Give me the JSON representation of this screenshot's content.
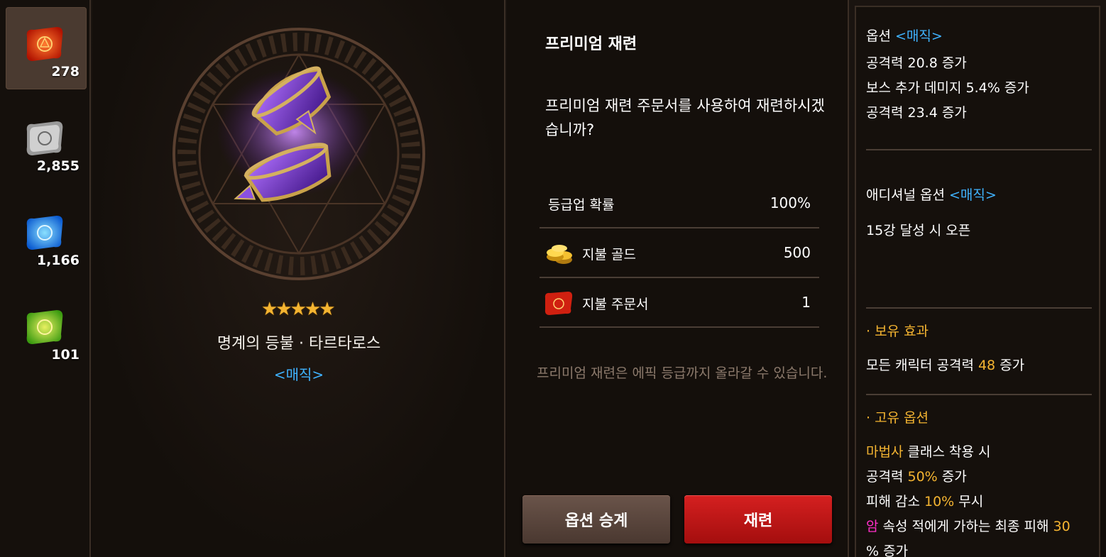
{
  "scrolls": [
    {
      "icon": "red-scroll-icon",
      "count": "278",
      "color": "#e02a10",
      "active": true
    },
    {
      "icon": "silver-scroll-icon",
      "count": "2,855",
      "color": "#b8b8b8",
      "active": false
    },
    {
      "icon": "blue-scroll-icon",
      "count": "1,166",
      "color": "#1a8cff",
      "active": false
    },
    {
      "icon": "green-scroll-icon",
      "count": "101",
      "color": "#6ad420",
      "active": false
    }
  ],
  "item": {
    "stars": "★★★★★",
    "star_count": 5,
    "name": "명계의 등불 · 타르타로스",
    "grade": "<매직>"
  },
  "dialog": {
    "title": "프리미엄 재련",
    "question": "프리미엄 재련 주문서를 사용하여 재련하시겠습니까?",
    "rows": [
      {
        "label": "등급업 확률",
        "value": "100%",
        "icon": ""
      },
      {
        "label": "지불 골드",
        "value": "500",
        "icon": "gold-coins-icon"
      },
      {
        "label": "지불 주문서",
        "value": "1",
        "icon": "red-scroll-icon"
      }
    ],
    "note": "프리미엄 재련은 에픽 등급까지 올라갈 수 있습니다.",
    "btn_inherit": "옵션 승계",
    "btn_reroll": "재련"
  },
  "options": {
    "option_head": "옵션",
    "option_grade": "<매직>",
    "option_lines": [
      "공격력 20.8 증가",
      "보스 추가 데미지 5.4% 증가",
      "공격력 23.4 증가"
    ],
    "additional_head": "애디셔널 옵션",
    "additional_grade": "<매직>",
    "additional_lines": [
      "15강 달성 시 오픈"
    ],
    "possess_head": "· 보유 효과",
    "possess_prefix": "모든 캐릭터 공격력 ",
    "possess_value": "48",
    "possess_suffix": " 증가",
    "unique_head": "· 고유 옵션",
    "unique_class": "마법사",
    "unique_class_suffix": " 클래스 착용 시",
    "unique_atk_prefix": "공격력 ",
    "unique_atk_value": "50%",
    "unique_atk_suffix": " 증가",
    "unique_dmg_prefix": "피해 감소 ",
    "unique_dmg_value": "10%",
    "unique_dmg_suffix": " 무시",
    "unique_elem": "암",
    "unique_elem_mid": " 속성 적에게 가하는 최종 피해 ",
    "unique_elem_value": "30",
    "unique_elem_tail": "% 증가"
  }
}
